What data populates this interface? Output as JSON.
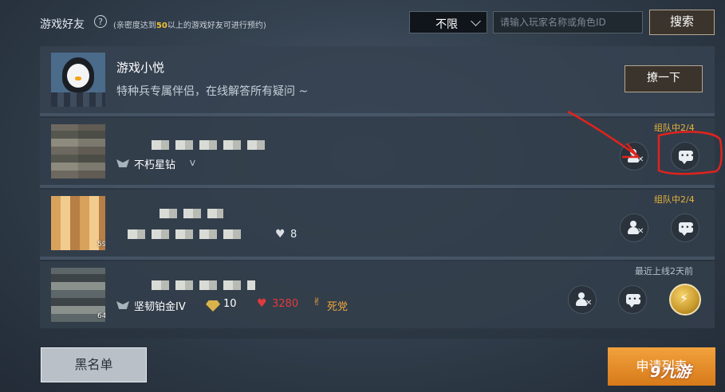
{
  "header": {
    "title": "游戏好友",
    "hint_prefix": "(亲密度达到",
    "hint_value": "50",
    "hint_suffix": "以上的游戏好友可进行预约)",
    "filter_value": "不限",
    "search_placeholder": "请输入玩家名称或角色ID",
    "search_label": "搜索"
  },
  "assistant": {
    "name": "游戏小悦",
    "description": "特种兵专属伴侣，在线解答所有疑问 ~",
    "action_label": "撩一下"
  },
  "friends": [
    {
      "name": "不朽星钻",
      "tag": "V",
      "status": "组队中2/4",
      "status_color": "#e7b43a"
    },
    {
      "level": "59",
      "likes": "8",
      "status": "组队中2/4",
      "status_color": "#e7b43a"
    },
    {
      "rank": "坚韧铂金IV",
      "level": "64",
      "tier_num": "10",
      "intimacy": "3280",
      "relation": "死党",
      "status": "最近上线2天前",
      "status_color": "#b8c1cb"
    }
  ],
  "footer": {
    "blacklist_label": "黑名单",
    "apply_label": "申请列表"
  },
  "watermark": "9九游",
  "colors": {
    "accent_gold": "#e7b43a",
    "annotation_red": "#e0231c",
    "apply_orange": "#e58a25"
  }
}
